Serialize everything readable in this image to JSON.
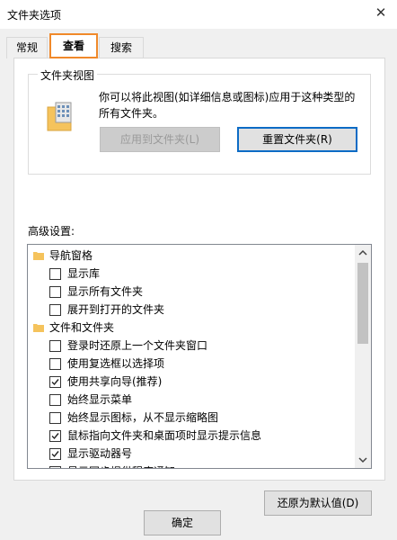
{
  "window": {
    "title": "文件夹选项",
    "close_glyph": "✕"
  },
  "tabs": [
    {
      "label": "常规",
      "active": false
    },
    {
      "label": "查看",
      "active": true
    },
    {
      "label": "搜索",
      "active": false
    }
  ],
  "folder_views": {
    "legend": "文件夹视图",
    "description": "你可以将此视图(如详细信息或图标)应用于这种类型的所有文件夹。",
    "apply_button": "应用到文件夹(L)",
    "reset_button": "重置文件夹(R)"
  },
  "advanced": {
    "label": "高级设置:",
    "items": [
      {
        "kind": "category",
        "label": "导航窗格"
      },
      {
        "kind": "option",
        "label": "显示库",
        "checked": false
      },
      {
        "kind": "option",
        "label": "显示所有文件夹",
        "checked": false
      },
      {
        "kind": "option",
        "label": "展开到打开的文件夹",
        "checked": false
      },
      {
        "kind": "category",
        "label": "文件和文件夹"
      },
      {
        "kind": "option",
        "label": "登录时还原上一个文件夹窗口",
        "checked": false
      },
      {
        "kind": "option",
        "label": "使用复选框以选择项",
        "checked": false
      },
      {
        "kind": "option",
        "label": "使用共享向导(推荐)",
        "checked": true
      },
      {
        "kind": "option",
        "label": "始终显示菜单",
        "checked": false
      },
      {
        "kind": "option",
        "label": "始终显示图标，从不显示缩略图",
        "checked": false
      },
      {
        "kind": "option",
        "label": "鼠标指向文件夹和桌面项时显示提示信息",
        "checked": true
      },
      {
        "kind": "option",
        "label": "显示驱动器号",
        "checked": true
      },
      {
        "kind": "option",
        "label": "显示同步提供程序通知",
        "checked": true
      }
    ]
  },
  "restore_button": "还原为默认值(D)",
  "ok_button": "确定",
  "colors": {
    "active_tab_border": "#f0892a",
    "default_button_border": "#0c6bc5",
    "folder_icon": "#f5c35c"
  }
}
